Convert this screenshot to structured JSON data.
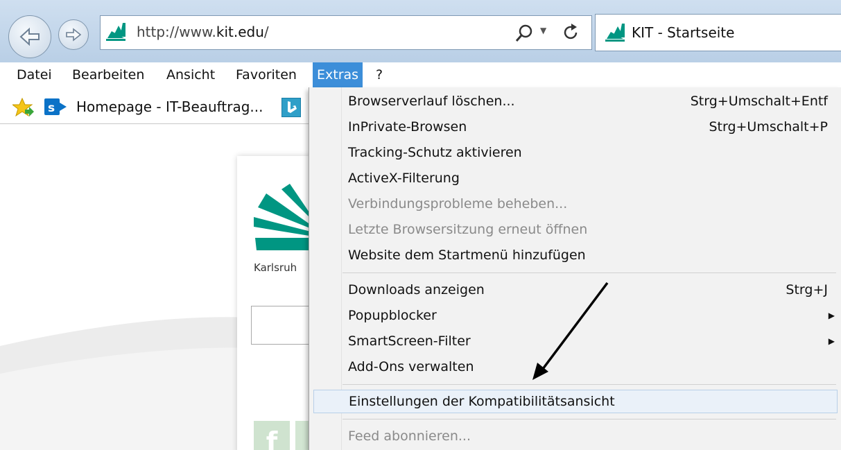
{
  "toolbar": {
    "url": "http://www.kit.edu/",
    "url_prefix": "http://www.",
    "url_domain": "kit.edu",
    "url_suffix": "/",
    "tab_title": "KIT - Startseite"
  },
  "menubar": {
    "items": [
      "Datei",
      "Bearbeiten",
      "Ansicht",
      "Favoriten",
      "Extras",
      "?"
    ]
  },
  "favorites_bar": {
    "homepage_label": "Homepage - IT-Beauftrag..."
  },
  "page": {
    "logo_caption": "Karlsruh"
  },
  "extras_menu": {
    "items": [
      {
        "label": "Browserverlauf löschen...",
        "shortcut": "Strg+Umschalt+Entf"
      },
      {
        "label": "InPrivate-Browsen",
        "shortcut": "Strg+Umschalt+P"
      },
      {
        "label": "Tracking-Schutz aktivieren",
        "shortcut": ""
      },
      {
        "label": "ActiveX-Filterung",
        "shortcut": ""
      },
      {
        "label": "Verbindungsprobleme beheben...",
        "shortcut": "",
        "disabled": true
      },
      {
        "label": "Letzte Browsersitzung erneut öffnen",
        "shortcut": "",
        "disabled": true
      },
      {
        "label": "Website dem Startmenü hinzufügen",
        "shortcut": ""
      },
      {
        "label": "Downloads anzeigen",
        "shortcut": "Strg+J"
      },
      {
        "label": "Popupblocker",
        "shortcut": "",
        "submenu": true
      },
      {
        "label": "SmartScreen-Filter",
        "shortcut": "",
        "submenu": true
      },
      {
        "label": "Add-Ons verwalten",
        "shortcut": ""
      },
      {
        "label": "Einstellungen der Kompatibilitätsansicht",
        "shortcut": "",
        "highlighted": true
      },
      {
        "label": "Feed abonnieren...",
        "shortcut": "",
        "disabled": true
      }
    ]
  },
  "colors": {
    "kit_green": "#009682",
    "menu_active": "#3c8ed9",
    "bing_blue": "#2f9fc8",
    "sharepoint_blue": "#0b72c7"
  }
}
